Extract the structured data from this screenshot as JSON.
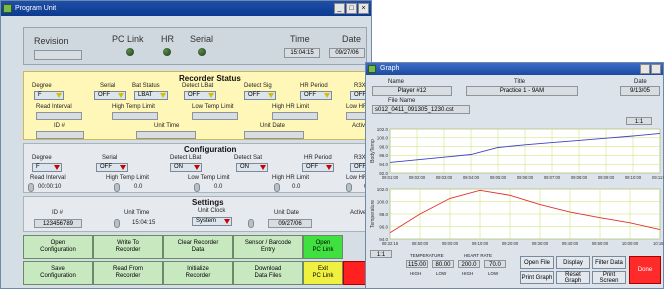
{
  "program": {
    "title": "Program Unit",
    "controls": [
      "_",
      "□",
      "×"
    ],
    "revision_label": "Revision",
    "pclink_label": "PC Link",
    "hr_label": "HR",
    "serial_label": "Serial",
    "time_label": "Time",
    "time_value": "15:04:15",
    "date_label": "Date",
    "date_value": "09/27/06",
    "recorder_status": {
      "title": "Recorder Status",
      "labels": [
        "Degree",
        "Serial",
        "Bat Status",
        "Detect LBat",
        "Detect Sig",
        "HR Period",
        "R3X F"
      ],
      "values": [
        "F",
        "OFF",
        "LBAT",
        "OFF",
        "OFF",
        "OFF",
        "OFF"
      ],
      "row2": [
        "Read Interval",
        "High Temp Limit",
        "Low Temp Limit",
        "High HR Limit",
        "Low HR Li"
      ],
      "row3": [
        "ID #",
        "Unit Time",
        "Unit Date",
        "Active"
      ]
    },
    "configuration": {
      "title": "Configuration",
      "labels": [
        "Degree",
        "Serial",
        "Detect LBat",
        "Detect Sat",
        "HR Period",
        "R3X F"
      ],
      "values": [
        "F",
        "OFF",
        "ON",
        "ON",
        "OFF",
        "OFF"
      ],
      "row2_labels": [
        "Read Interval",
        "High Temp Limit",
        "Low Temp Limit",
        "High HR Limit",
        "Low HR L"
      ],
      "row2_values": [
        "00:00:10",
        "0.0",
        "0.0",
        "0.0",
        "0"
      ]
    },
    "settings": {
      "title": "Settings",
      "labels": [
        "ID #",
        "Unit Time",
        "Unit Clock",
        "Unit Date",
        "Active"
      ],
      "id_value": "123456789",
      "time_value": "15:04:15",
      "clock_value": "System",
      "date_value": "09/27/06"
    },
    "buttons": [
      [
        "Open\nConfiguration",
        "Write To\nRecorder",
        "Clear Recorder\nData",
        "Sensor / Barcode\nEntry",
        "Open\nPC Link"
      ],
      [
        "Save\nConfiguration",
        "Read From\nRecorder",
        "Initialize\nRecorder",
        "Download\nData Files",
        "Exit\nPC Link"
      ]
    ]
  },
  "graph": {
    "title": "Graph",
    "name_label": "Name",
    "name_value": "Player #12",
    "title_label": "Title",
    "title_value": "Practice 1 - 9AM",
    "date_label": "Date",
    "date_value": "9/13/05",
    "file_label": "File Name",
    "file_value": "s012_0411_091305_1230.cst",
    "zoom_label": "1:1",
    "zoom_label2": "1:1",
    "top_chart": {
      "ylabel": "BodyTemp",
      "yticks": [
        "102.0",
        "100.0",
        "98.0",
        "96.0",
        "94.0",
        "92.0"
      ],
      "xticks": [
        "09:01:00",
        "09:02:00",
        "09:03:00",
        "09:04:00",
        "09:05:00",
        "09:06:00",
        "09:07:00",
        "09:08:00",
        "09:09:00",
        "09:10:00",
        "09:11:00"
      ]
    },
    "bottom_chart": {
      "ylabel": "Temperature",
      "yticks": [
        "102.0",
        "100.0",
        "98.0",
        "96.0",
        "94.0"
      ],
      "xticks": [
        "08:32:15",
        "08:50:00",
        "09:00:00",
        "09:10:00",
        "09:20:00",
        "09:30:00",
        "09:40:00",
        "09:50:00",
        "10:00:00",
        "10:15:2"
      ]
    },
    "limits": {
      "temp_label": "TEMPERATURE",
      "hr_label": "HEART RATE",
      "values": [
        "115.00",
        "80.00",
        "200.0",
        "70.0"
      ],
      "sub": [
        "HIGH",
        "LOW",
        "HIGH",
        "LOW"
      ]
    },
    "buttons": [
      "Open File",
      "Display",
      "Filter Data",
      "Print Graph",
      "Reset Graph",
      "Print Screen",
      "Done"
    ]
  },
  "chart_data": [
    {
      "type": "line",
      "ylabel": "BodyTemp",
      "ylim": [
        92,
        102
      ],
      "x": [
        "09:01:00",
        "09:02:00",
        "09:03:00",
        "09:04:00",
        "09:05:00",
        "09:06:00",
        "09:07:00",
        "09:08:00",
        "09:09:00",
        "09:10:00",
        "09:11:00"
      ],
      "series": [
        {
          "values": [
            94.4,
            95.0,
            95.6,
            96.2,
            97.8,
            98.4,
            98.9,
            99.4,
            99.9,
            100.4,
            101.0
          ]
        }
      ]
    },
    {
      "type": "line",
      "ylabel": "Temperature",
      "ylim": [
        94,
        102
      ],
      "x": [
        "08:32:15",
        "08:50:00",
        "09:00:00",
        "09:10:00",
        "09:20:00",
        "09:30:00",
        "09:40:00",
        "09:50:00",
        "10:00:00",
        "10:15:2"
      ],
      "series": [
        {
          "values": [
            95.0,
            98.0,
            100.5,
            101.8,
            101.0,
            99.5,
            98.3,
            97.4,
            96.6,
            95.5
          ]
        }
      ]
    }
  ]
}
